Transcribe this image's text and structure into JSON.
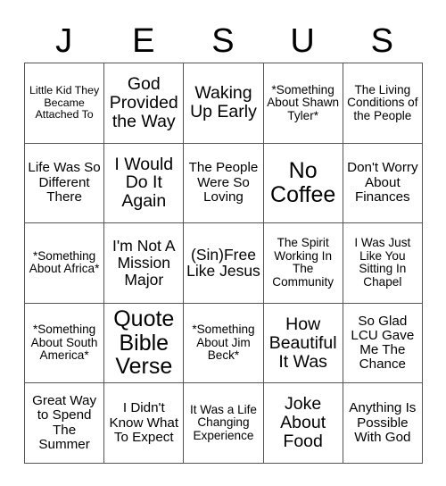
{
  "card": {
    "header_letters": [
      "J",
      "E",
      "S",
      "U",
      "S"
    ],
    "grid": {
      "rows": 5,
      "columns": 5,
      "cells": [
        [
          {
            "text": "Little Kid They Became Attached To",
            "size": "fs-xs"
          },
          {
            "text": "God Provided the Way",
            "size": "fs-xl"
          },
          {
            "text": "Waking Up Early",
            "size": "fs-xl"
          },
          {
            "text": "*Something About Shawn Tyler*",
            "size": "fs-s"
          },
          {
            "text": "The Living Conditions of the People",
            "size": "fs-s"
          }
        ],
        [
          {
            "text": "Life Was So Different There",
            "size": "fs-m"
          },
          {
            "text": "I Would Do It Again",
            "size": "fs-xl"
          },
          {
            "text": "The People Were So Loving",
            "size": "fs-m"
          },
          {
            "text": "No Coffee",
            "size": "fs-xxl"
          },
          {
            "text": "Don't Worry About Finances",
            "size": "fs-m"
          }
        ],
        [
          {
            "text": "*Something About Africa*",
            "size": "fs-s"
          },
          {
            "text": "I'm Not A Mission Major",
            "size": "fs-l"
          },
          {
            "text": "(Sin)Free Like Jesus",
            "size": "fs-l"
          },
          {
            "text": "The Spirit Working In The Community",
            "size": "fs-s"
          },
          {
            "text": "I Was Just Like You Sitting In Chapel",
            "size": "fs-s"
          }
        ],
        [
          {
            "text": "*Something About South America*",
            "size": "fs-s"
          },
          {
            "text": "Quote Bible Verse",
            "size": "fs-xxl"
          },
          {
            "text": "*Something About Jim Beck*",
            "size": "fs-s"
          },
          {
            "text": "How Beautiful It Was",
            "size": "fs-xl"
          },
          {
            "text": "So Glad LCU Gave Me The Chance",
            "size": "fs-m"
          }
        ],
        [
          {
            "text": "Great Way to Spend The Summer",
            "size": "fs-m"
          },
          {
            "text": "I Didn't Know What To Expect",
            "size": "fs-m"
          },
          {
            "text": "It Was a Life Changing Experience",
            "size": "fs-s"
          },
          {
            "text": "Joke About Food",
            "size": "fs-xl"
          },
          {
            "text": "Anything Is Possible With God",
            "size": "fs-m"
          }
        ]
      ]
    },
    "colors": {
      "border": "#545454",
      "text": "#000000",
      "background": "#ffffff"
    }
  }
}
